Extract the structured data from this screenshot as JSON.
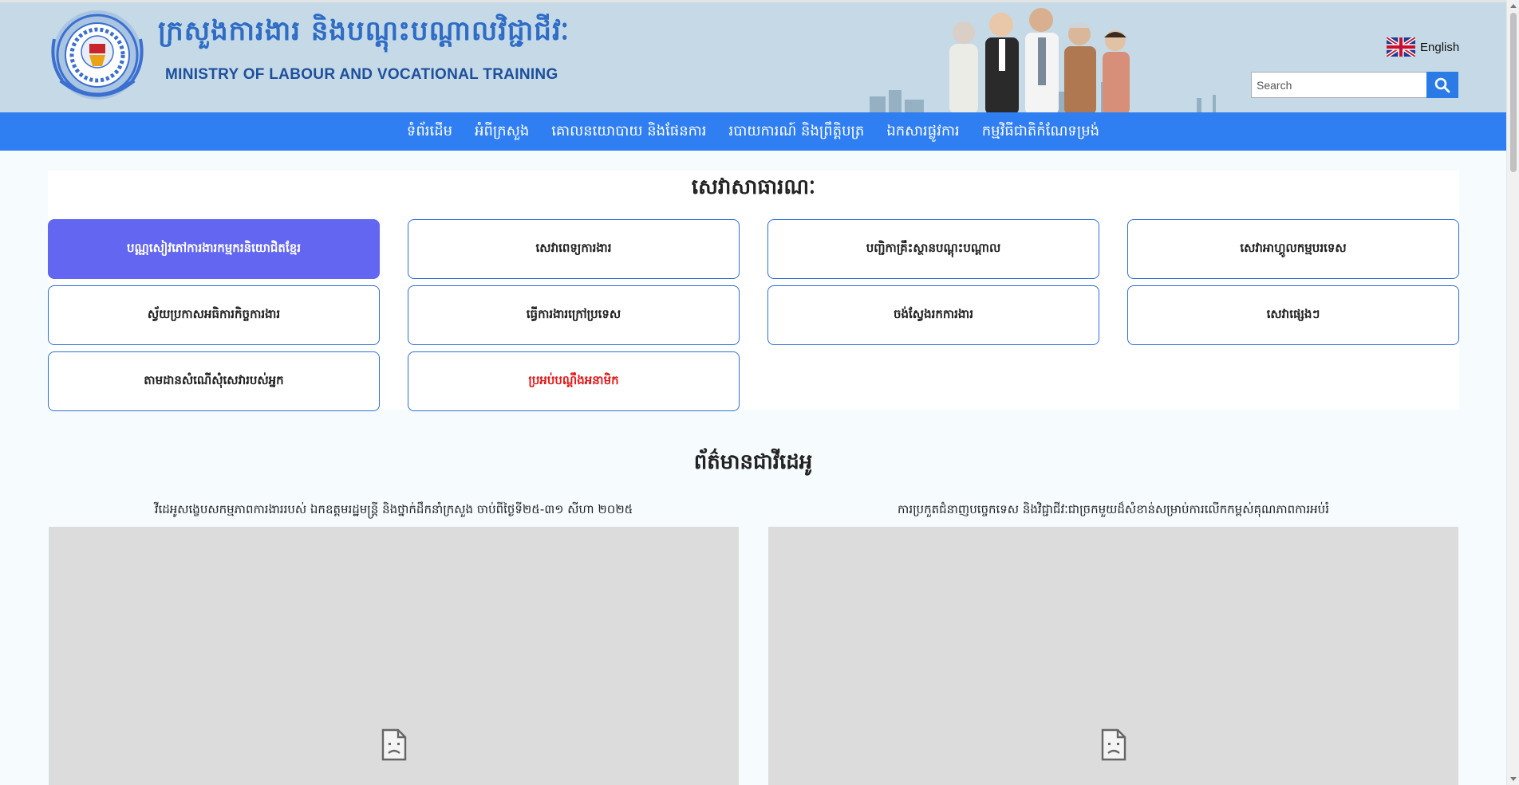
{
  "header": {
    "title_kh": "ក្រសួងការងារ និងបណ្តុះបណ្តាលវិជ្ជាជីវៈ",
    "title_en": "MINISTRY OF LABOUR AND VOCATIONAL TRAINING",
    "logo_icon": "ministry-seal-icon",
    "language_label": "English",
    "language_flag_icon": "uk-flag-icon",
    "search_placeholder": "Search",
    "search_icon": "search-icon",
    "nav_color": "#2f7ef2",
    "header_bg": "#c5dae6"
  },
  "nav": {
    "items": [
      "ទំព័រដើម",
      "អំពីក្រសួង",
      "គោលនយោបាយ និងផែនការ",
      "របាយការណ៍ និងព្រឹត្តិបត្រ",
      "ឯកសារផ្លូវការ",
      "កម្មវិធីជាតិកំណែទម្រង់"
    ]
  },
  "services": {
    "title": "សេវាសាធារណៈ",
    "items": [
      {
        "label": "បណ្ណសៀវភៅការងារកម្មករនិយោជិតខ្មែរ",
        "state": "active"
      },
      {
        "label": "សេវាពេទ្យការងារ",
        "state": "normal"
      },
      {
        "label": "បញ្ជិកាគ្រឹះស្ថានបណ្តុះបណ្តាល",
        "state": "normal"
      },
      {
        "label": "សេវាអាហ្គូលកម្មបរទេស",
        "state": "normal"
      },
      {
        "label": "ស្វ័យប្រកាសអធិការកិច្ចការងារ",
        "state": "normal"
      },
      {
        "label": "ធ្វើការងារក្រៅប្រទេស",
        "state": "normal"
      },
      {
        "label": "ចង់ស្វែងរកការងារ",
        "state": "normal"
      },
      {
        "label": "សេវាផ្សេងៗ",
        "state": "normal"
      },
      {
        "label": "តាមដានសំណើសុំសេវារបស់អ្នក",
        "state": "normal"
      },
      {
        "label": "ប្រអប់បណ្តឹងអនាមិក",
        "state": "highlight-red"
      }
    ],
    "active_color": "#6266f0",
    "highlight_color": "#e41b1b"
  },
  "news": {
    "title": "ព័ត៌មានជាវីដេអូ",
    "items": [
      {
        "caption": "វីដេអូសង្ខេបសកម្មភាពការងាររបស់ ឯកឧត្តមរដ្ឋមន្ត្រី និងថ្នាក់ដឹកនាំក្រសួង ចាប់ពីថ្ងៃទី២៥-៣១ សីហា ២០២៥",
        "media_icon": "broken-video-icon"
      },
      {
        "caption": "ការប្រកួតជំនាញបច្ចេកទេស និងវិជ្ជាជីវៈជាច្រកមួយដ៏សំខាន់សម្រាប់ការលើកកម្ពស់គុណភាពការអប់រំ",
        "media_icon": "broken-video-icon"
      }
    ]
  }
}
